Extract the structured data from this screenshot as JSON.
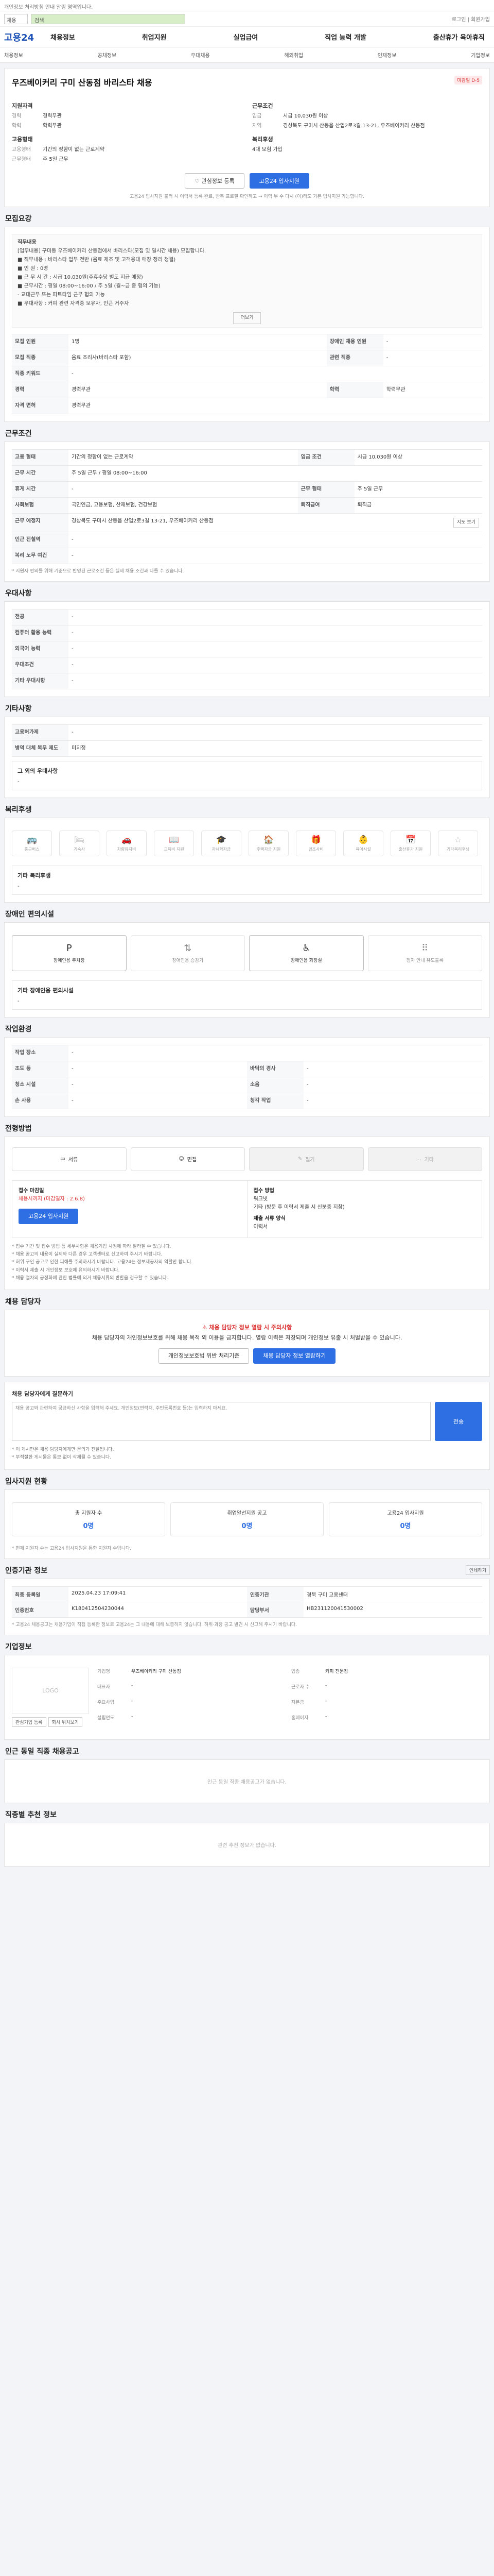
{
  "topbar": {
    "notice": "개인정보 처리방침 안내 알림 영역입니다."
  },
  "search": {
    "select": "채용",
    "query": "검색",
    "right_links": "로그인 | 회원가입"
  },
  "gnb": {
    "logo": "고용24",
    "menu": [
      "채용정보",
      "취업지원",
      "실업급여",
      "직업 능력 개발",
      "출산휴가 육아휴직"
    ]
  },
  "subnav": [
    "채용정보",
    "공채정보",
    "우대채용",
    "해외취업",
    "인재정보",
    "기업정보"
  ],
  "job": {
    "title": "우즈베이커리 구미 산동점 바리스타 채용",
    "badge": "마감일 D-5",
    "section_applicant": "지원자격",
    "section_conditions": "근무조건",
    "section_company": "고용형태",
    "section_welfare": "복리후생",
    "applicant": [
      {
        "k": "경력",
        "v": "경력무관"
      },
      {
        "k": "학력",
        "v": "학력무관"
      }
    ],
    "conditions": [
      {
        "k": "임금",
        "v": "시급 10,030원 이상"
      },
      {
        "k": "지역",
        "v": "경상북도 구미시 산동읍 산업2로3길 13-21, 우즈베이커리 산동점"
      }
    ],
    "employ": [
      {
        "k": "고용형태",
        "v": "기간의 정함이 없는 근로계약"
      },
      {
        "k": "근무형태",
        "v": "주 5일 근무"
      }
    ],
    "welfare": [
      {
        "k": "",
        "v": "4대 보험 가입"
      }
    ],
    "btn_interest": "관심정보 등록",
    "btn_apply": "고용24 입사지원",
    "apply_note": "고용24 입사지원 불러 시 이력서 등록 완료, 반복 프로필 확인하고 → 이력 부 수 다시 (이)라도 기본 입사지원 가능합니다.",
    "apply_note_link": "반복 프로필 확인하고"
  },
  "recruit": {
    "heading": "모집요강",
    "desc_title": "직무내용",
    "desc": [
      "[업무내용] 구미동 우즈베이커리 산동점에서 바리스타(모집 및 일시간 채용) 모집합니다.",
      "■ 직무내용 : 바리스타 업무 전반 (음료 제조 및 고객응대 매장 정리 청결)",
      "■ 인  원 : 0명",
      "■ 근 무 시 간 : 시급 10,030원(주휴수당 별도 지급 예정)",
      "■ 근무시간 : 평일 08:00~16:00 / 주 5일 (월~금 중 협의 가능)",
      "- 교대근무 또는 파트타임 근무 협의 가능",
      "■ 우대사항 : 커피 관련 자격증 보유자, 인근 거주자"
    ],
    "more": "더보기",
    "rows": [
      {
        "k1": "모집 인원",
        "v1": "1명",
        "k2": "장애인 채용 인원",
        "v2": "-"
      },
      {
        "k1": "모집 직종",
        "v1": "음료 조리사(바리스타 포함)",
        "k2": "관련 직종",
        "v2": "-"
      },
      {
        "k1": "직종 키워드",
        "v1": "-",
        "k2": "",
        "v2": ""
      },
      {
        "k1": "경력",
        "v1": "경력무관",
        "k2": "학력",
        "v2": "학력무관"
      },
      {
        "k1": "자격 면허",
        "v1": "경력무관",
        "k2": "",
        "v2": ""
      }
    ]
  },
  "work": {
    "heading": "근무조건",
    "rows": [
      {
        "k1": "고용 형태",
        "v1": "기간의 정함이 없는 근로계약",
        "k2": "임금 조건",
        "v2": "시급 10,030원 이상"
      },
      {
        "k1": "근무 시간",
        "v1": "주 5일 근무 / 평일 08:00~16:00",
        "k2": "",
        "v2": ""
      },
      {
        "k1": "휴게 시간",
        "v1": "-",
        "k2": "근무 형태",
        "v2": "주 5일 근무"
      },
      {
        "k1": "사회보험",
        "v1": "국민연금, 고용보험, 산재보험, 건강보험",
        "k2": "퇴직급여",
        "v2": "퇴직금"
      },
      {
        "k1": "근무 예정지",
        "v1": "경상북도 구미시 산동읍 산업2로3길 13-21, 우즈베이커리 산동점",
        "k2": "",
        "v2": ""
      },
      {
        "k1": "인근 전철역",
        "v1": "-",
        "k2": "",
        "v2": ""
      },
      {
        "k1": "복리 노무 여건",
        "v1": "-",
        "k2": "",
        "v2": ""
      }
    ],
    "map_btn": "지도 보기",
    "note": "* 지원자 편의를 위해 기준으로 반영된 근로조건 등은 실제 채용 조건과 다를 수 있습니다."
  },
  "prefer": {
    "heading": "우대사항",
    "rows": [
      {
        "k": "전공",
        "v": "-"
      },
      {
        "k": "컴퓨터 활용 능력",
        "v": "-"
      },
      {
        "k": "외국어 능력",
        "v": "-"
      },
      {
        "k": "우대조건",
        "v": "-"
      },
      {
        "k": "기타 우대사항",
        "v": "-"
      }
    ]
  },
  "other": {
    "heading": "기타사항",
    "rows": [
      {
        "k": "고용허가제",
        "v": "-"
      },
      {
        "k": "병역 대체 복무 제도",
        "v": "미지정"
      }
    ],
    "box_title": "그 외의 우대사항",
    "box_value": "-"
  },
  "benefit": {
    "heading": "복리후생",
    "items": [
      "통근버스",
      "기숙사",
      "차량유지비",
      "교육비 지원",
      "자녀학자금",
      "주택자금 지원",
      "경조사비",
      "육아시설",
      "출산휴가 지원",
      "기타복리후생"
    ],
    "box_title": "기타 복리후생",
    "box_value": "-"
  },
  "disability": {
    "heading": "장애인 편의시설",
    "items": [
      "장애인용 주차장",
      "장애인용 승강기",
      "장애인용 화장실",
      "점자 안내 유도블록"
    ],
    "box_title": "기타 장애인용 편의시설",
    "box_value": "-"
  },
  "environment": {
    "heading": "작업환경",
    "rows": [
      {
        "k1": "작업 장소",
        "v1": "-",
        "k2": "",
        "v2": ""
      },
      {
        "k1": "조도 등",
        "v1": "-",
        "k2": "바닥의 경사",
        "v2": "-"
      },
      {
        "k1": "청소 시설",
        "v1": "-",
        "k2": "소음",
        "v2": "-"
      },
      {
        "k1": "손 사용",
        "v1": "-",
        "k2": "청각 작업",
        "v2": "-"
      }
    ]
  },
  "method": {
    "heading": "전형방법",
    "steps": [
      "서류",
      "면접",
      "필기",
      "기타"
    ],
    "deadline_label": "접수 마감일",
    "deadline": "채용시까지 (마감일자 : 2.6.8)",
    "way_label": "접수 방법",
    "way": [
      "워크넷",
      "기타 (방문 후 이력서 제출 시 신분증 지참)"
    ],
    "doc_label": "제출 서류 양식",
    "doc": "이력서",
    "btn_apply": "고용24 입사지원",
    "bullets": [
      "* 접수 기간 및 접수 방법 등 세부사항은 채용기업 사정에 따라 달라질 수 있습니다.",
      "* 채용 공고의 내용이 실제와 다른 경우 고객센터로 신고하여 주시기 바랍니다.",
      "* 허위 구인 공고로 인한 피해를 주의하시기 바랍니다. 고용24는 정보제공자의 역할만 합니다.",
      "* 이력서 제출 시 개인정보 보호에 유의하시기 바랍니다.",
      "* 채용 절차의 공정화에 관한 법률에 의거 채용서류의 반환을 청구할 수 있습니다."
    ]
  },
  "contact": {
    "heading": "채용 담당자",
    "warn_title": "채용 담당자 정보 열람 시 주의사항",
    "warn_body": "채용 담당자의 개인정보보호를 위해 채용 목적 외 이용을 금지합니다. 열람 이력은 저장되며 개인정보 유출 시 처벌받을 수 있습니다.",
    "btn_privacy": "개인정보보호법 위반 처리기준",
    "btn_view": "채용 담당자 정보 열람하기"
  },
  "inquiry": {
    "heading": "채용 담당자에게 질문하기",
    "placeholder": "채용 공고와 관련하여 궁금하신 사항을 입력해 주세요. 개인정보(연락처, 주민등록번호 등)는 입력하지 마세요.",
    "btn": "전송",
    "note1": "* 이 게시판은 채용 담당자에게만 문의가 전달됩니다.",
    "note2": "* 부적절한 게시물은 통보 없이 삭제될 수 있습니다."
  },
  "status": {
    "heading": "입사지원 현황",
    "items": [
      {
        "label": "총 지원자 수",
        "n": "0명"
      },
      {
        "label": "취업알선지원 공고",
        "n": "0명"
      },
      {
        "label": "고용24 입사지원",
        "n": "0명"
      }
    ],
    "note": "* 현재 지원자 수는 고용24 입사지원을 통한 지원자 수입니다."
  },
  "info": {
    "heading": "인증기관 정보",
    "print": "인쇄하기",
    "rows": [
      {
        "k1": "최종 등록일",
        "v1": "2025.04.23 17:09:41",
        "k2": "인증기관",
        "v2": "경북 구미 고용센터"
      },
      {
        "k1": "인증번호",
        "v1": "K180412504230044",
        "k2": "담당부서",
        "v2": "HB231120041530002"
      }
    ],
    "note": "* 고용24 채용공고는 채용기업이 직접 등록한 정보로 고용24는 그 내용에 대해 보증하지 않습니다. 허위·과장 공고 발견 시 신고해 주시기 바랍니다."
  },
  "company": {
    "heading": "기업정보",
    "logo": "LOGO",
    "btn_follow": "관심기업 등록",
    "btn_map": "회사 위치보기",
    "fields": [
      {
        "k": "기업명",
        "v": "우즈베이커리 구미 산동점"
      },
      {
        "k": "업종",
        "v": "커피 전문점"
      },
      {
        "k": "대표자",
        "v": "-"
      },
      {
        "k": "근로자 수",
        "v": "-"
      },
      {
        "k": "주요사업",
        "v": "-"
      },
      {
        "k": "자본금",
        "v": "-"
      },
      {
        "k": "설립연도",
        "v": "-"
      },
      {
        "k": "홈페이지",
        "v": "-"
      }
    ]
  },
  "related": {
    "heading": "인근 동일 직종 채용공고",
    "empty": "인근 동일 직종 채용공고가 없습니다."
  },
  "recommend": {
    "heading": "직종별 추천 정보",
    "empty": "관련 추천 정보가 없습니다."
  }
}
